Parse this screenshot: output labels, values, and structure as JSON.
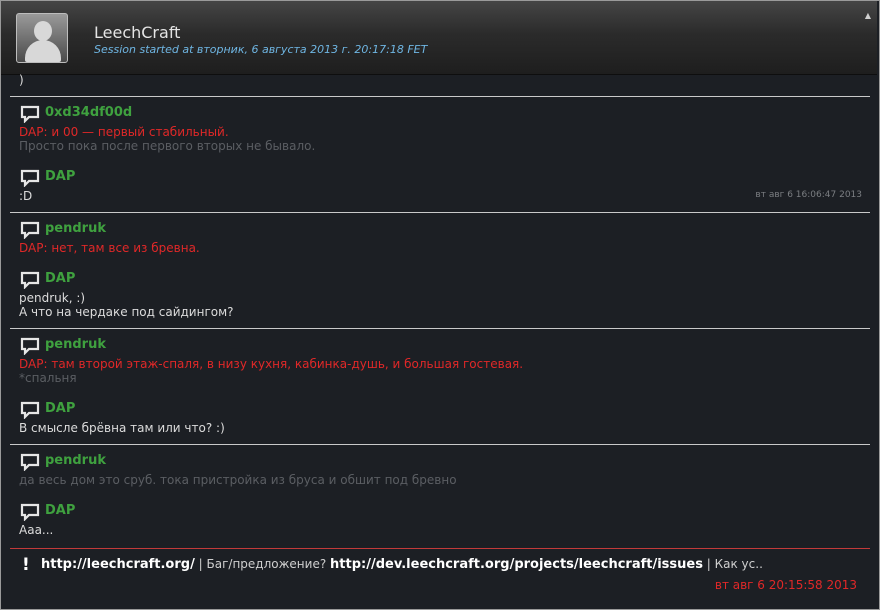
{
  "header": {
    "title": "LeechCraft",
    "subtitle": "Session started at вторник, 6 августа 2013 г. 20:17:18 FET",
    "scroll_arrow": "▲"
  },
  "messages": {
    "partial": ")",
    "m1": {
      "nick": "0xd34df00d",
      "line1": "DAP: и 00 — первый стабильный.",
      "line2": "Просто пока после первого вторых не бывало."
    },
    "m2": {
      "nick": "DAP",
      "line1": ":D",
      "time": "вт авг 6 16:06:47 2013"
    },
    "m3": {
      "nick": "pendruk",
      "line1": "DAP: нет, там все из бревна."
    },
    "m4": {
      "nick": "DAP",
      "line1": "pendruk, :)",
      "line2": "А что на чердаке под сайдингом?"
    },
    "m5": {
      "nick": "pendruk",
      "line1": "DAP: там второй этаж-спаля, в низу кухня, кабинка-душь, и большая гостевая.",
      "line2": "*спальня"
    },
    "m6": {
      "nick": "DAP",
      "line1": "В смысле брёвна там или что? :)"
    },
    "m7": {
      "nick": "pendruk",
      "line1": "да весь дом это сруб. тока пристройка из бруса и обшит под бревно"
    },
    "m8": {
      "nick": "DAP",
      "line1": "Ааа..."
    }
  },
  "topic": {
    "icon": "!",
    "link1": "http://leechcraft.org/",
    "text1": " | Баг/предложение? ",
    "link2": "http://dev.leechcraft.org/projects/leechcraft/issues",
    "text2": " | Как ус..",
    "time": "вт авг 6 20:15:58 2013"
  },
  "colors": {
    "nick": "#3fa13f",
    "highlight": "#e02828",
    "faded": "#5b5e63",
    "normal": "#dcdcdc",
    "subtitle": "#6fb6e3"
  }
}
